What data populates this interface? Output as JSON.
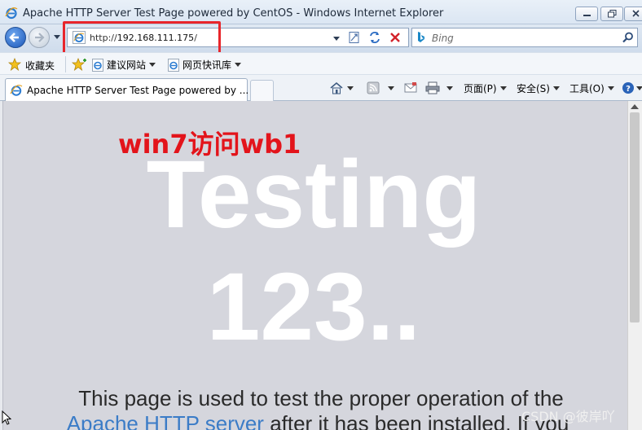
{
  "window": {
    "title": "Apache HTTP Server Test Page powered by CentOS - Windows Internet Explorer"
  },
  "address_bar": {
    "url_prefix": "http://",
    "url_host": "192.168.111.175",
    "url_suffix": "/"
  },
  "search": {
    "placeholder": "Bing"
  },
  "favorites_bar": {
    "favorites_label": "收藏夹",
    "items": [
      {
        "label": "建议网站"
      },
      {
        "label": "网页快讯库"
      }
    ]
  },
  "tabs": [
    {
      "title": "Apache HTTP Server Test Page powered by ..."
    }
  ],
  "command_bar": {
    "page_label": "页面(P)",
    "safety_label": "安全(S)",
    "tools_label": "工具(O)"
  },
  "page": {
    "annotation": "win7访问wb1",
    "heading_line1": "Testing",
    "heading_line2": "123..",
    "body_line1": "This page is used to test the proper operation of the",
    "body_link": "Apache HTTP server",
    "body_line2_rest": " after it has been installed. If you"
  },
  "watermark": "CSDN @彼岸吖",
  "colors": {
    "annotation_red": "#e3141b",
    "highlight_box": "#e8262b",
    "content_bg": "#d5d6dd",
    "link_blue": "#3b7cc7"
  }
}
